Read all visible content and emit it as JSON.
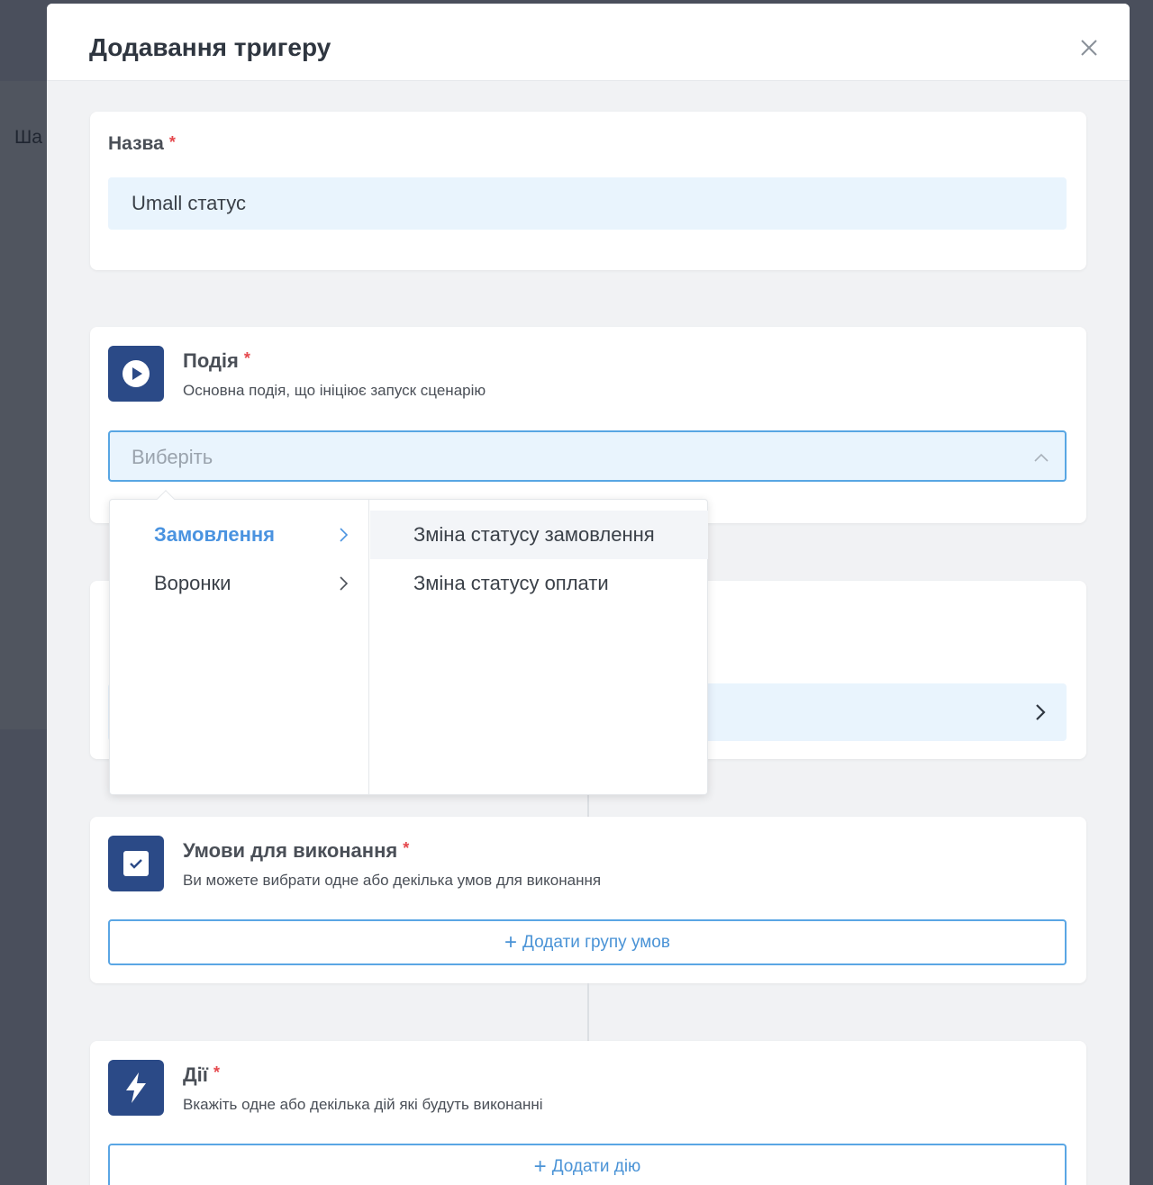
{
  "background": {
    "partial_text": "Ша"
  },
  "modal": {
    "title": "Додавання тригеру"
  },
  "name_section": {
    "label": "Назва",
    "required_mark": "*",
    "value": "Umall статус"
  },
  "event_section": {
    "icon": "play-icon",
    "title": "Подія",
    "required_mark": "*",
    "description": "Основна подія, що ініціює запуск сценарію",
    "select_placeholder": "Виберіть"
  },
  "cascader": {
    "categories": [
      {
        "label": "Замовлення",
        "active": true
      },
      {
        "label": "Воронки",
        "active": false
      }
    ],
    "options": [
      {
        "label": "Зміна статусу замовлення",
        "hovered": true
      },
      {
        "label": "Зміна статусу оплати",
        "hovered": false
      }
    ]
  },
  "conditions_section": {
    "icon": "checkbox-icon",
    "title": "Умови для виконання",
    "required_mark": "*",
    "description": "Ви можете вибрати одне або декілька умов для виконання",
    "add_button": "Додати групу умов"
  },
  "actions_section": {
    "icon": "lightning-icon",
    "title": "Дії",
    "required_mark": "*",
    "description": "Вкажіть одне або декілька дій які будуть виконанні",
    "add_button": "Додати дію"
  },
  "colors": {
    "accent": "#4a93e0",
    "icon_bg": "#2b4a87",
    "required": "#e5484d",
    "input_bg": "#e9f4fd"
  }
}
